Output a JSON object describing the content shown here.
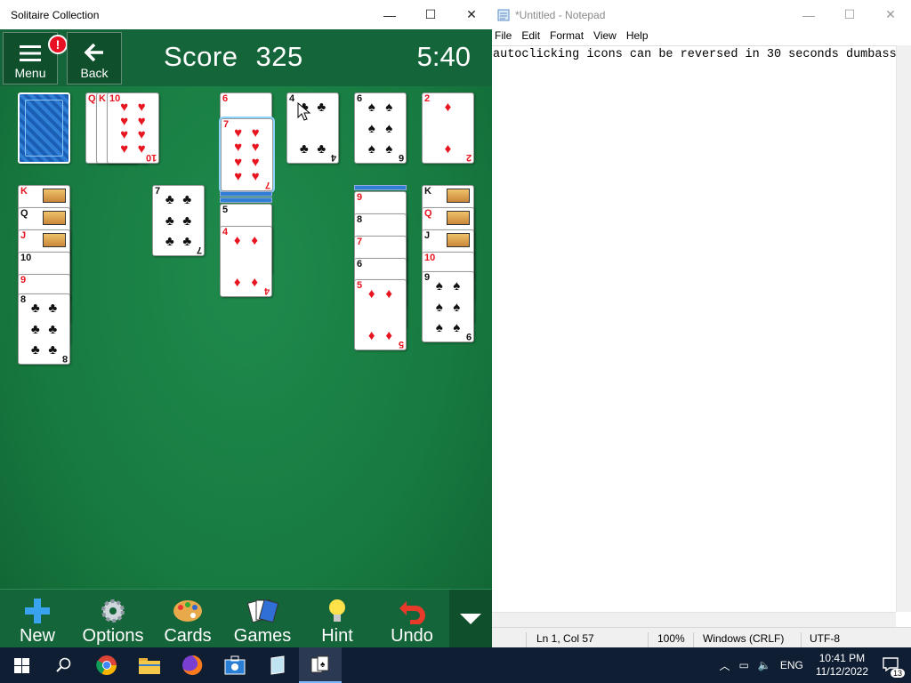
{
  "solitaire": {
    "window_title": "Solitaire Collection",
    "menu_label": "Menu",
    "menu_badge": "!",
    "back_label": "Back",
    "score_label": "Score",
    "score_value": "325",
    "timer": "5:40",
    "waste_ranks": [
      "Q",
      "K",
      "10"
    ],
    "foundations": [
      {
        "rank": "6",
        "suit": "♥",
        "color": "#e8141f"
      },
      {
        "rank": "4",
        "suit": "♣",
        "color": "#111111"
      },
      {
        "rank": "6",
        "suit": "♠",
        "color": "#111111"
      },
      {
        "rank": "2",
        "suit": "♦",
        "color": "#e8141f"
      }
    ],
    "dragged_card": {
      "rank": "7",
      "suit": "♥"
    },
    "tableau": [
      {
        "cards": [
          "K",
          "Q",
          "J",
          "10",
          "9",
          "8"
        ]
      },
      {
        "cards": [
          "7"
        ]
      },
      {
        "cards": [
          "5",
          "4"
        ]
      },
      {
        "cards": [
          "9",
          "8",
          "7",
          "6",
          "5"
        ]
      },
      {
        "cards": [
          "K",
          "Q",
          "J",
          "10",
          "9"
        ]
      }
    ],
    "toolbar": {
      "new": "New",
      "options": "Options",
      "cards": "Cards",
      "games": "Games",
      "hint": "Hint",
      "undo": "Undo"
    }
  },
  "notepad": {
    "window_title": "*Untitled - Notepad",
    "menu": [
      "File",
      "Edit",
      "Format",
      "View",
      "Help"
    ],
    "text": "autoclicking icons can be reversed in 30 seconds dumbass",
    "status": {
      "position": "Ln 1, Col 57",
      "zoom": "100%",
      "line_ending": "Windows (CRLF)",
      "encoding": "UTF-8"
    }
  },
  "taskbar": {
    "language": "ENG",
    "time": "10:41 PM",
    "date": "11/12/2022",
    "notification_count": "13"
  },
  "colors": {
    "felt": "#177a40",
    "bar": "#15653a",
    "taskbar": "#0f1e33"
  }
}
